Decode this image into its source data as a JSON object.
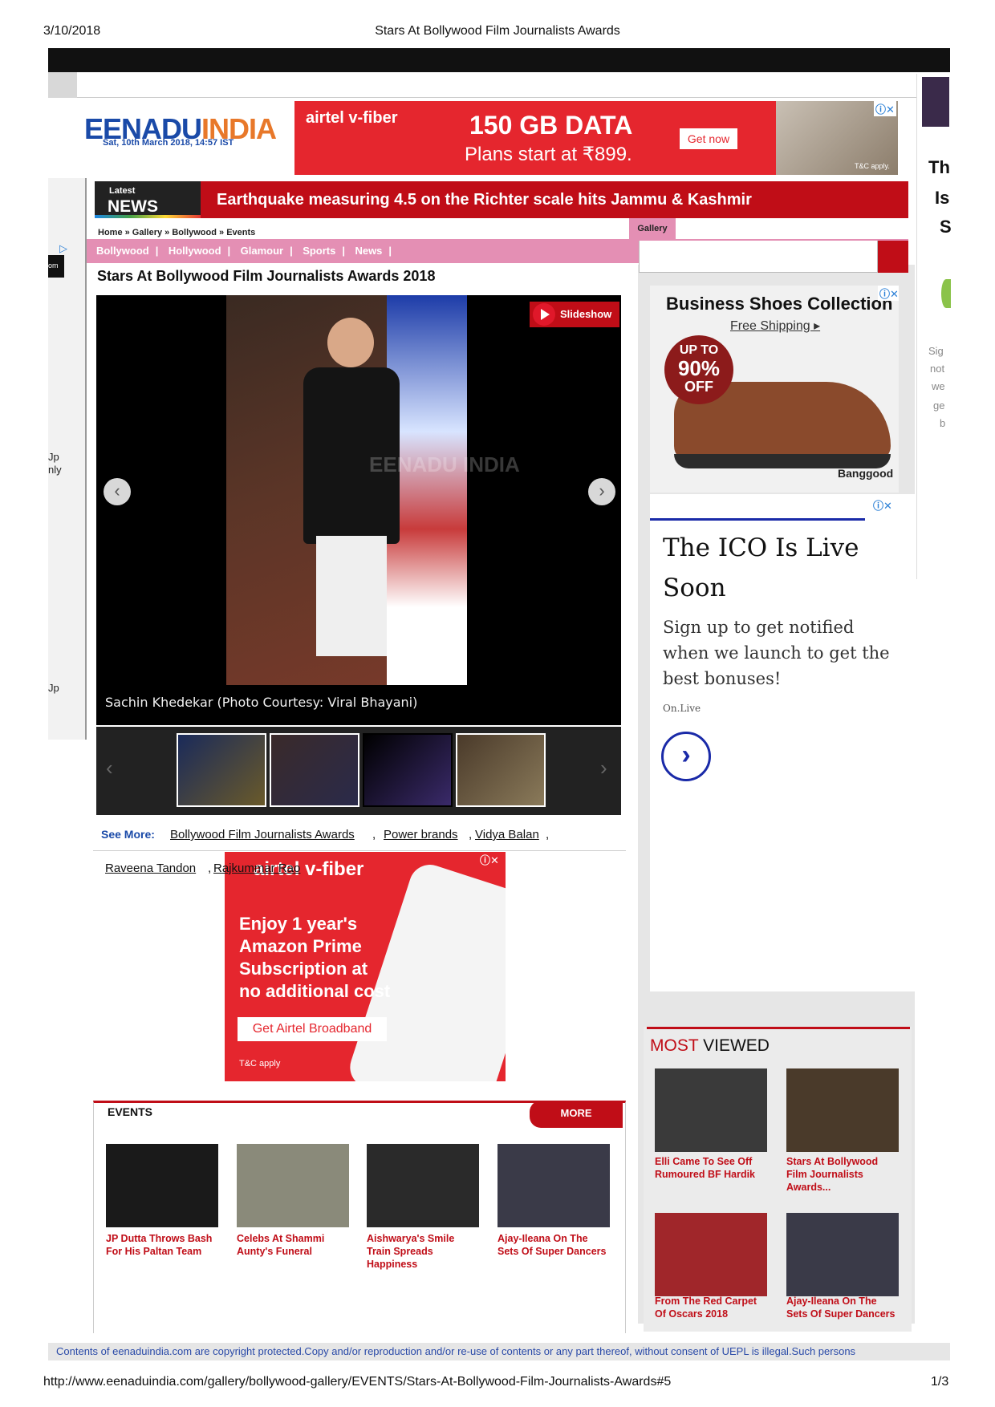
{
  "print": {
    "date": "3/10/2018",
    "title": "Stars At Bollywood Film Journalists Awards",
    "url": "http://www.eenaduindia.com/gallery/bollywood-gallery/EVENTS/Stars-At-Bollywood-Film-Journalists-Awards#5",
    "page": "1/3"
  },
  "logo": {
    "part1": "EENADU",
    "part2": "INDIA",
    "datetime": "Sat, 10th March 2018, 14:57 IST"
  },
  "ad_top": {
    "brand": "airtel v-fiber",
    "headline": "150 GB DATA",
    "subline": "Plans start at ₹899.",
    "cta": "Get now",
    "tc": "T&C apply."
  },
  "ticker": {
    "label_small": "Latest",
    "label_big": "NEWS",
    "headline": "Earthquake measuring 4.5 on the Richter scale hits Jammu & Kashmir"
  },
  "gallery_tab": "Gallery",
  "breadcrumb": [
    "Home",
    "Gallery",
    "Bollywood",
    "Events"
  ],
  "categories": [
    "Bollywood",
    "Hollywood",
    "Glamour",
    "Sports",
    "News"
  ],
  "page_title": "Stars At Bollywood Film Journalists Awards 2018",
  "viewer": {
    "slideshow": "Slideshow",
    "caption": "Sachin Khedekar (Photo Courtesy: Viral Bhayani)",
    "watermark": "EENADU INDIA",
    "prev": "‹",
    "next": "›"
  },
  "see_more": {
    "label": "See More:",
    "links": [
      "Bollywood Film Journalists Awards",
      "Power brands",
      "Vidya Balan",
      "Raveena Tandon",
      "Rajkummar Rao"
    ]
  },
  "ad_mid": {
    "brand": "airtel v-fiber",
    "line1": "Enjoy 1 year's Amazon Prime Subscription at no additional cost",
    "cta": "Get Airtel Broadband",
    "tc": "T&C apply"
  },
  "events": {
    "title": "EVENTS",
    "more": "MORE",
    "items": [
      {
        "title": "JP Dutta Throws Bash For His Paltan Team",
        "color": "#1a1a1a"
      },
      {
        "title": "Celebs At Shammi Aunty's Funeral",
        "color": "#8a8a7a"
      },
      {
        "title": "Aishwarya's Smile Train Spreads Happiness",
        "color": "#2a2a2a"
      },
      {
        "title": "Ajay-Ileana On The Sets Of Super Dancers",
        "color": "#3a3a48"
      }
    ]
  },
  "shoe_ad": {
    "title": "Business Shoes Collection",
    "shipping": "Free Shipping ▸",
    "badge_a": "UP TO",
    "badge_b": "90%",
    "badge_c": "OFF",
    "brand": "Banggood"
  },
  "ico_ad": {
    "headline": "The ICO Is Live Soon",
    "body": "Sign up to get notified when we launch to get the best bonuses!",
    "source": "On.Live",
    "go": "›"
  },
  "most_viewed": {
    "title_a": "MOST",
    "title_b": " VIEWED",
    "items": [
      {
        "title": "Elli Came To See Off Rumoured BF Hardik",
        "color": "#3a3a3a"
      },
      {
        "title": "Stars At Bollywood Film Journalists Awards...",
        "color": "#4a3a2a"
      },
      {
        "title": "From The Red Carpet Of Oscars 2018",
        "color": "#a0262a"
      },
      {
        "title": "Ajay-Ileana On The Sets Of Super Dancers",
        "color": "#3a3a48"
      }
    ]
  },
  "left_fragments": [
    "om",
    "Jp",
    "nly",
    "Jp"
  ],
  "right_fragments": [
    "Th",
    "Is",
    "S",
    "Sig",
    "not",
    "we",
    "ge",
    "b"
  ],
  "copyright": "Contents of eenaduindia.com are copyright protected.Copy and/or reproduction and/or re-use of contents or any part thereof, without consent of UEPL is illegal.Such persons",
  "colors": {
    "brand_red": "#c00d17",
    "airtel_red": "#e5262e",
    "pink_nav": "#e48fb4",
    "logo_blue": "#1a4aa8"
  }
}
